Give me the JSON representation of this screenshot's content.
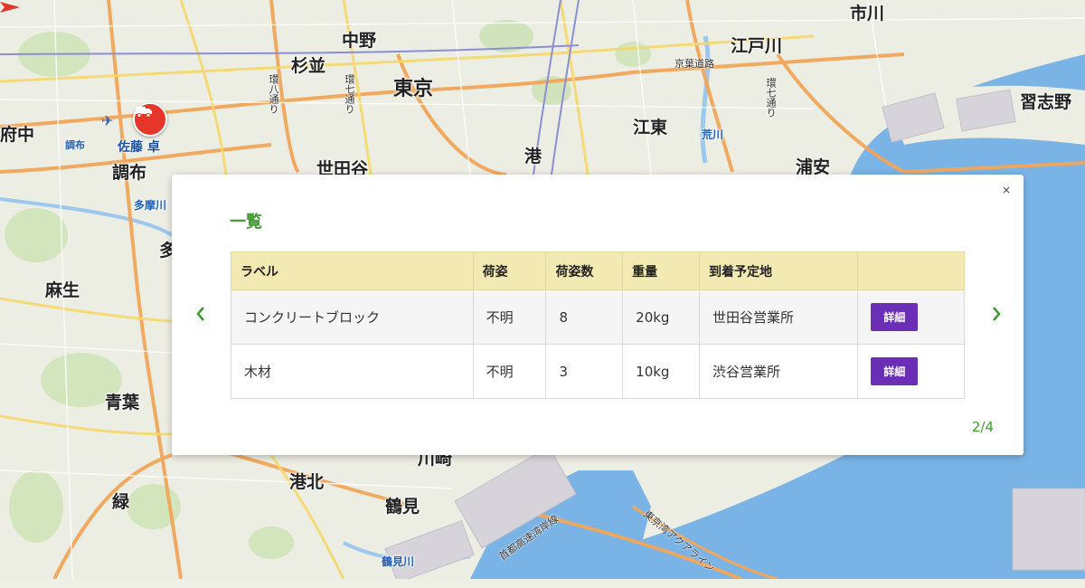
{
  "map": {
    "places": [
      {
        "id": "nakano",
        "label": "中野",
        "size": "md"
      },
      {
        "id": "suginami",
        "label": "杉並",
        "size": "md"
      },
      {
        "id": "tokyo",
        "label": "東京",
        "size": "lg"
      },
      {
        "id": "edogawa",
        "label": "江戸川",
        "size": "md"
      },
      {
        "id": "narashino",
        "label": "習志野",
        "size": "md"
      },
      {
        "id": "fuchu",
        "label": "府中",
        "size": "md"
      },
      {
        "id": "chofu",
        "label": "調布",
        "size": "md"
      },
      {
        "id": "koto",
        "label": "江東",
        "size": "md"
      },
      {
        "id": "minato",
        "label": "港",
        "size": "md"
      },
      {
        "id": "setagaya",
        "label": "世田谷",
        "size": "md"
      },
      {
        "id": "urayasu",
        "label": "浦安",
        "size": "md"
      },
      {
        "id": "asao",
        "label": "麻生",
        "size": "md"
      },
      {
        "id": "aoba",
        "label": "青葉",
        "size": "md"
      },
      {
        "id": "midori",
        "label": "緑",
        "size": "md"
      },
      {
        "id": "kohoku",
        "label": "港北",
        "size": "md"
      },
      {
        "id": "tsurumi",
        "label": "鶴見",
        "size": "md"
      },
      {
        "id": "kawasaki",
        "label": "川崎",
        "size": "md"
      },
      {
        "id": "ichikawa",
        "label": "市川",
        "size": "md"
      },
      {
        "id": "tama",
        "label": "多",
        "size": "md"
      }
    ],
    "blue_labels": {
      "chofu_small": "調布",
      "tamagawa": "多摩川",
      "arakawa": "荒川",
      "tsurumigawa": "鶴見川"
    },
    "road_labels": {
      "keiyo": "京葉道路",
      "kan8": "環八通り",
      "kan7": "環七通り",
      "kan7b": "環七通り",
      "shuto": "首都高速湾岸線",
      "aqualine": "東京湾アクアライン"
    },
    "driver_name": "佐藤 卓",
    "marker_color": "#e6352b"
  },
  "modal": {
    "title": "一覧",
    "close_label": "×",
    "prev_icon": "chevron-left",
    "next_icon": "chevron-right",
    "columns": [
      "ラベル",
      "荷姿",
      "荷姿数",
      "重量",
      "到着予定地",
      ""
    ],
    "rows": [
      {
        "label": "コンクリートブロック",
        "packaging": "不明",
        "count": "8",
        "weight": "20kg",
        "destination": "世田谷営業所",
        "action": "詳細"
      },
      {
        "label": "木材",
        "packaging": "不明",
        "count": "3",
        "weight": "10kg",
        "destination": "渋谷営業所",
        "action": "詳細"
      }
    ],
    "pager": "2/4",
    "accent_color": "#3f9b2f",
    "header_color": "#f3e9b3",
    "button_color": "#6a2fb5"
  }
}
